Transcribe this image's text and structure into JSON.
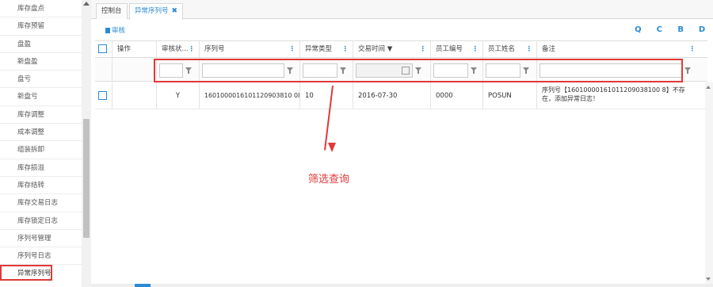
{
  "sidebar": {
    "items": [
      {
        "label": "库存盘点"
      },
      {
        "label": "库存预留"
      },
      {
        "label": "盘盈"
      },
      {
        "label": "新盘盈"
      },
      {
        "label": "盘亏"
      },
      {
        "label": "新盘亏"
      },
      {
        "label": "库存调整"
      },
      {
        "label": "成本调整"
      },
      {
        "label": "组装拆卸"
      },
      {
        "label": "库存损溢"
      },
      {
        "label": "库存结转"
      },
      {
        "label": "库存交易日志"
      },
      {
        "label": "库存锁定日志"
      },
      {
        "label": "序列号管理"
      },
      {
        "label": "序列号日志"
      },
      {
        "label": "异常序列号",
        "active": true
      }
    ]
  },
  "tabs": {
    "home": "控制台",
    "current": "异常序列号",
    "close": "✖"
  },
  "toolbar": {
    "audit_label": "审核",
    "icons": [
      "search-icon",
      "refresh-icon",
      "save-icon",
      "undo-icon"
    ],
    "icon_glyphs": {
      "search": "Q",
      "refresh": "C",
      "save": "B",
      "undo": "D"
    }
  },
  "grid": {
    "columns": [
      {
        "key": "select",
        "label": ""
      },
      {
        "key": "op",
        "label": "操作"
      },
      {
        "key": "status",
        "label": "审核状..."
      },
      {
        "key": "serial",
        "label": "序列号"
      },
      {
        "key": "type",
        "label": "异常类型"
      },
      {
        "key": "date",
        "label": "交易时间 ▼"
      },
      {
        "key": "empno",
        "label": "员工编号"
      },
      {
        "key": "empname",
        "label": "员工姓名"
      },
      {
        "key": "remark",
        "label": "备注"
      }
    ],
    "rows": [
      {
        "status": "Y",
        "serial": "1601000016101120903810 08",
        "serial_full": "16010000161011209038100 8",
        "type": "10",
        "date": "2016-07-30",
        "empno": "0000",
        "empname": "POSUN",
        "remark": "序列号【16010000161011209038100 8】不存在，添加异常日志！"
      }
    ]
  },
  "annotation": {
    "text": "筛选查询",
    "color": "#e03a3a"
  },
  "colors": {
    "accent": "#2a8bd4",
    "highlight": "#e03a3a"
  }
}
